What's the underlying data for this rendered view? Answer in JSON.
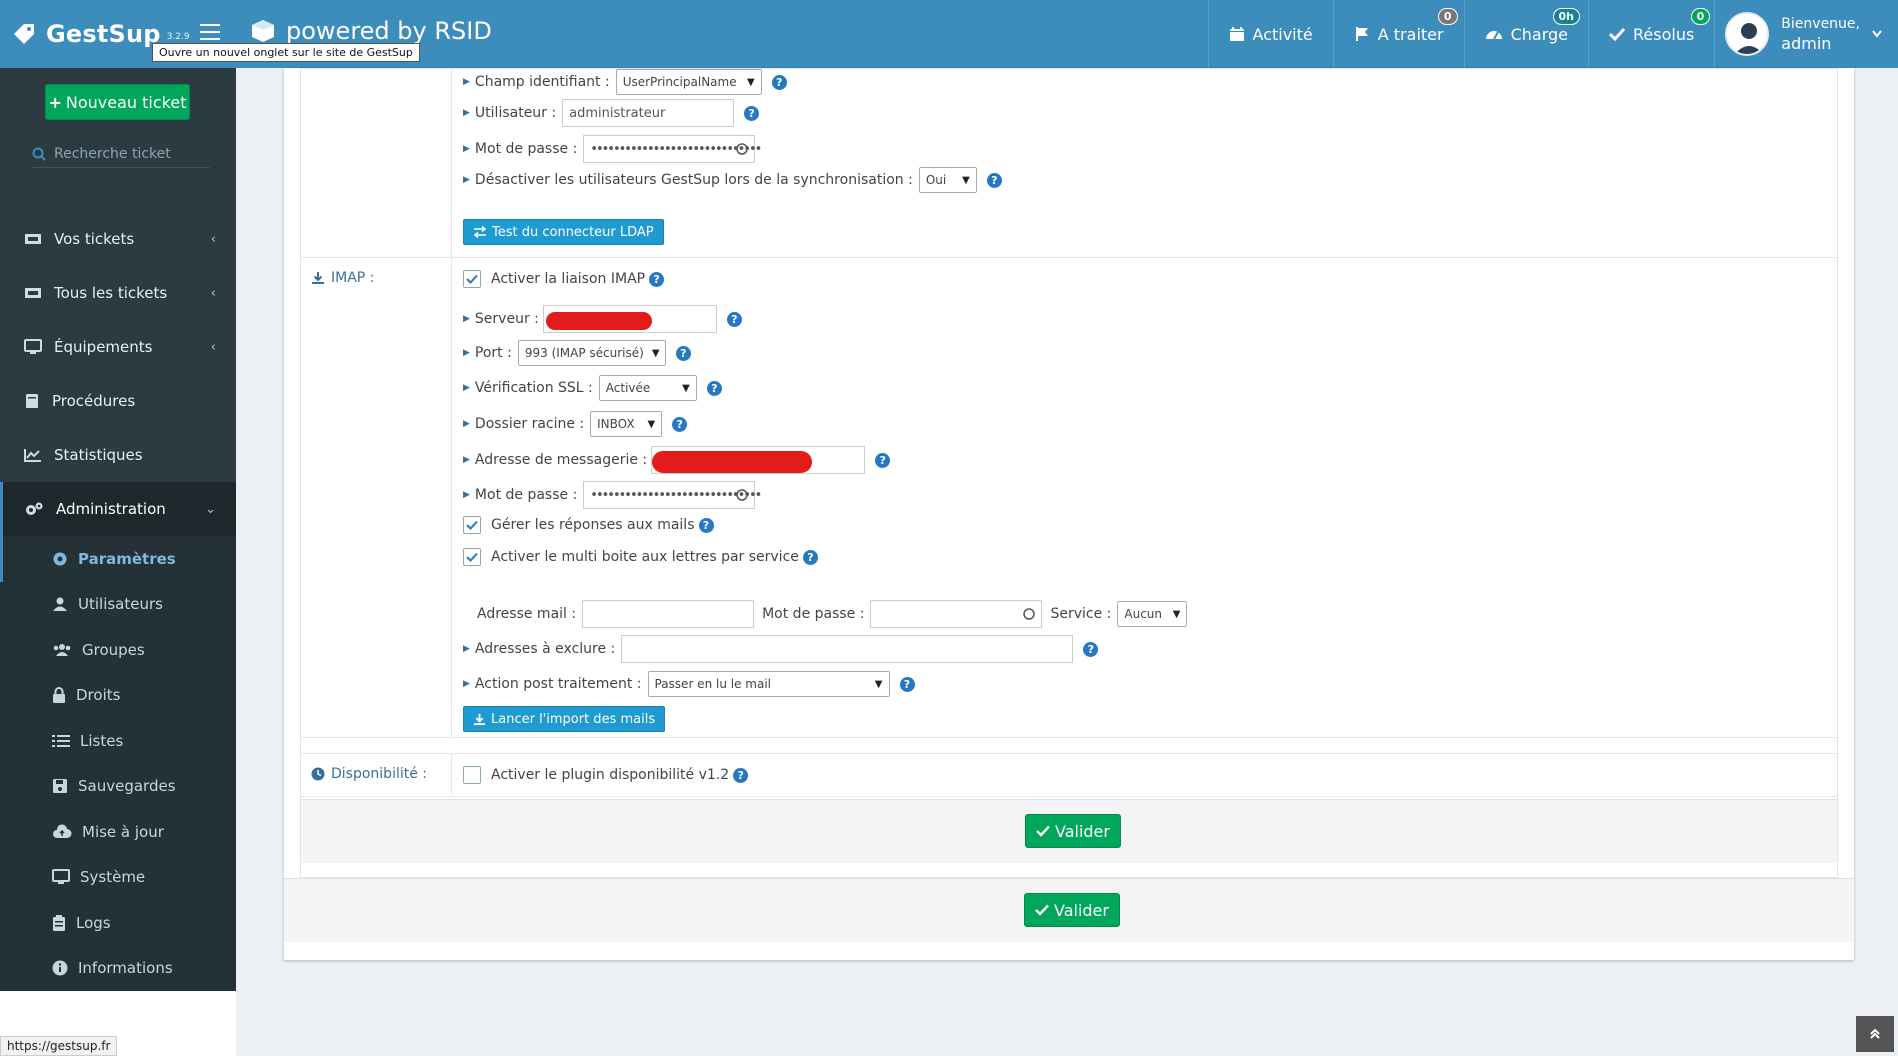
{
  "header": {
    "app_name": "GestSup",
    "version": "3.2.9",
    "tooltip": "Ouvre un nouvel onglet sur le site de GestSup",
    "powered": "powered by RSID",
    "nav": [
      {
        "label": "Activité",
        "icon": "calendar-icon",
        "badge": ""
      },
      {
        "label": "A traiter",
        "icon": "flag-icon",
        "badge": "0"
      },
      {
        "label": "Charge",
        "icon": "gauge-icon",
        "badge": "0h"
      },
      {
        "label": "Résolus",
        "icon": "check-icon",
        "badge": "0"
      }
    ],
    "user": {
      "greeting": "Bienvenue,",
      "name": "admin"
    }
  },
  "sidebar": {
    "new_ticket": "Nouveau ticket",
    "search_placeholder": "Recherche ticket",
    "items": [
      {
        "label": "Vos tickets",
        "icon": "ticket-icon"
      },
      {
        "label": "Tous les tickets",
        "icon": "tickets-icon"
      },
      {
        "label": "Équipements",
        "icon": "desktop-icon"
      },
      {
        "label": "Procédures",
        "icon": "book-icon"
      },
      {
        "label": "Statistiques",
        "icon": "chart-icon"
      },
      {
        "label": "Administration",
        "icon": "cogs-icon"
      }
    ],
    "subitems": [
      {
        "label": "Paramètres",
        "icon": "cog-icon"
      },
      {
        "label": "Utilisateurs",
        "icon": "user-icon"
      },
      {
        "label": "Groupes",
        "icon": "users-icon"
      },
      {
        "label": "Droits",
        "icon": "lock-icon"
      },
      {
        "label": "Listes",
        "icon": "list-icon"
      },
      {
        "label": "Sauvegardes",
        "icon": "save-icon"
      },
      {
        "label": "Mise à jour",
        "icon": "cloud-upload-icon"
      },
      {
        "label": "Système",
        "icon": "monitor-icon"
      },
      {
        "label": "Logs",
        "icon": "clipboard-icon"
      },
      {
        "label": "Informations",
        "icon": "info-icon"
      }
    ],
    "status_url": "https://gestsup.fr"
  },
  "ldap": {
    "champ_label": "Champ identifiant :",
    "champ_value": "UserPrincipalName",
    "user_label": "Utilisateur :",
    "user_value": "administrateur",
    "pwd_label": "Mot de passe :",
    "pwd_value": "••••••••••••••••••••••••••••••",
    "disable_label": "Désactiver les utilisateurs GestSup lors de la synchronisation :",
    "disable_value": "Oui",
    "test_button": "Test du connecteur LDAP"
  },
  "imap": {
    "section_label": "IMAP :",
    "activate_label": "Activer la liaison IMAP",
    "server_label": "Serveur :",
    "port_label": "Port :",
    "port_value": "993 (IMAP sécurisé)",
    "ssl_label": "Vérification SSL :",
    "ssl_value": "Activée",
    "folder_label": "Dossier racine :",
    "folder_value": "INBOX",
    "mail_label": "Adresse de messagerie :",
    "pwd_label": "Mot de passe :",
    "pwd_value": "••••••••••••••••••••••••••••••",
    "replies_label": "Gérer les réponses aux mails",
    "multi_label": "Activer le multi boite aux lettres par service",
    "multi_mail_label": "Adresse mail :",
    "multi_pwd_label": "Mot de passe :",
    "multi_service_label": "Service :",
    "multi_service_value": "Aucun",
    "exclude_label": "Adresses à exclure :",
    "post_label": "Action post traitement :",
    "post_value": "Passer en lu le mail",
    "import_button": "Lancer l'import des mails"
  },
  "dispo": {
    "section_label": "Disponibilité :",
    "plugin_label": "Activer le plugin disponibilité v1.2"
  },
  "buttons": {
    "validate1": "Valider",
    "validate2": "Valider"
  },
  "colors": {
    "topbar": "#3c8dbc",
    "sidebar": "#2c3b41",
    "green": "#00a65a",
    "blue_button": "#1f9bd1",
    "help": "#2579c4"
  }
}
